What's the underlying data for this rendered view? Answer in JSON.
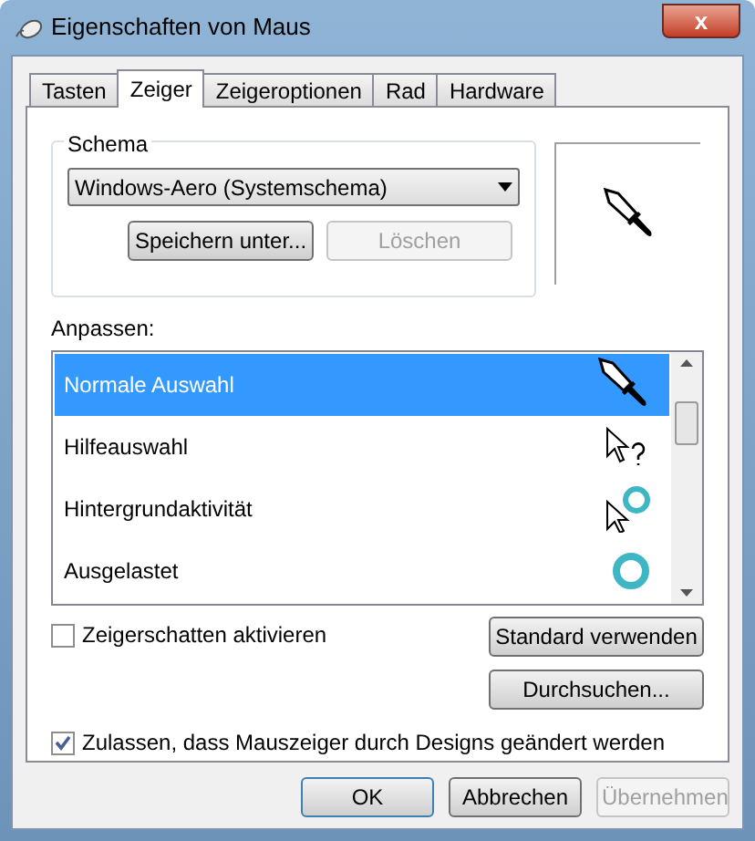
{
  "window": {
    "title": "Eigenschaften von Maus",
    "close": "x"
  },
  "tabs": [
    {
      "label": "Tasten",
      "selected": false
    },
    {
      "label": "Zeiger",
      "selected": true
    },
    {
      "label": "Zeigeroptionen",
      "selected": false
    },
    {
      "label": "Rad",
      "selected": false
    },
    {
      "label": "Hardware",
      "selected": false
    }
  ],
  "scheme": {
    "legend": "Schema",
    "value": "Windows-Aero (Systemschema)",
    "buttons": [
      {
        "label": "Speichern unter...",
        "disabled": false
      },
      {
        "label": "Löschen",
        "disabled": true
      }
    ]
  },
  "customize": {
    "label": "Anpassen:",
    "items": [
      {
        "label": "Normale Auswahl",
        "kind": "knife",
        "selected": true
      },
      {
        "label": "Hilfeauswahl",
        "kind": "help",
        "selected": false
      },
      {
        "label": "Hintergrundaktivität",
        "kind": "working",
        "selected": false
      },
      {
        "label": "Ausgelastet",
        "kind": "busy",
        "selected": false
      }
    ]
  },
  "shadow": {
    "label": "Zeigerschatten aktivieren",
    "checked": false
  },
  "side_buttons": [
    {
      "label": "Standard verwenden"
    },
    {
      "label": "Durchsuchen..."
    }
  ],
  "themes": {
    "label": "Zulassen, dass Mauszeiger durch Designs geändert werden",
    "checked": true
  },
  "buttons": [
    {
      "label": "OK",
      "default": true,
      "disabled": false
    },
    {
      "label": "Abbrechen",
      "default": false,
      "disabled": false
    },
    {
      "label": "Übernehmen",
      "default": false,
      "disabled": true
    }
  ]
}
